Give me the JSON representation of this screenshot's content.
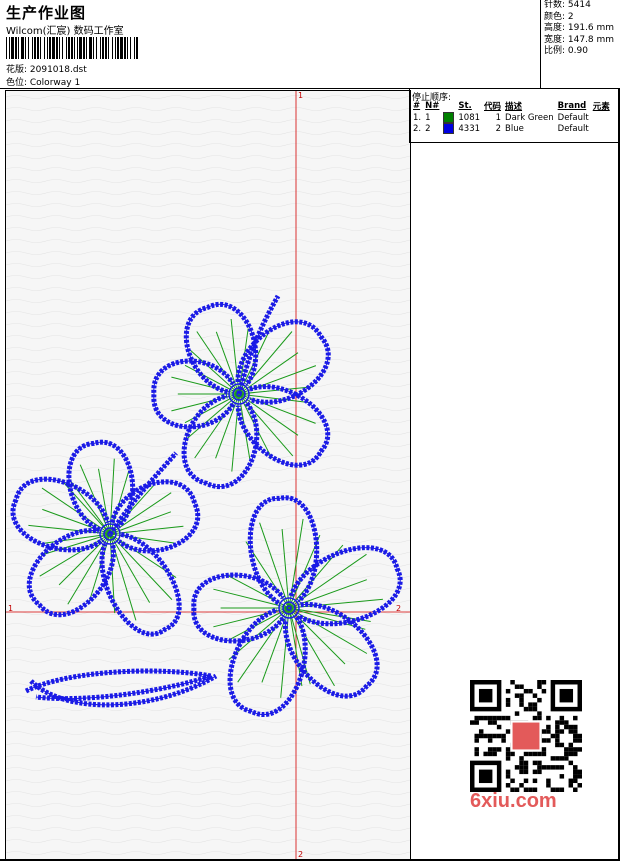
{
  "header": {
    "title": "生产作业图",
    "studio": "Wilcom(汇宸) 数码工作室",
    "file_line": "花版: 2091018.dst",
    "colorway_line": "色位: Colorway 1"
  },
  "stats": [
    "针数: 5414",
    "颜色: 2",
    "高度: 191.6 mm",
    "宽度: 147.8 mm",
    "比例: 0.90"
  ],
  "stop_sequence": {
    "title": "停止顺序:",
    "headers": [
      "#",
      "N#",
      "St.",
      "代码",
      "描述",
      "Brand",
      "元素"
    ],
    "rows": [
      {
        "num": "1.",
        "n": "1",
        "color": "#008000",
        "stitches": "1081",
        "code": "1",
        "desc": "Dark Green",
        "brand": "Default",
        "element": ""
      },
      {
        "num": "2.",
        "n": "2",
        "color": "#0000e0",
        "stitches": "4331",
        "code": "2",
        "desc": "Blue",
        "brand": "Default",
        "element": ""
      }
    ]
  },
  "markers": {
    "top": "1",
    "left": "1",
    "right": "2",
    "bottom": "2"
  },
  "watermark": "6xiu.com",
  "colors": {
    "outline": "#1a1ae6",
    "fill": "#1a9a1a",
    "axis": "#d40000"
  }
}
